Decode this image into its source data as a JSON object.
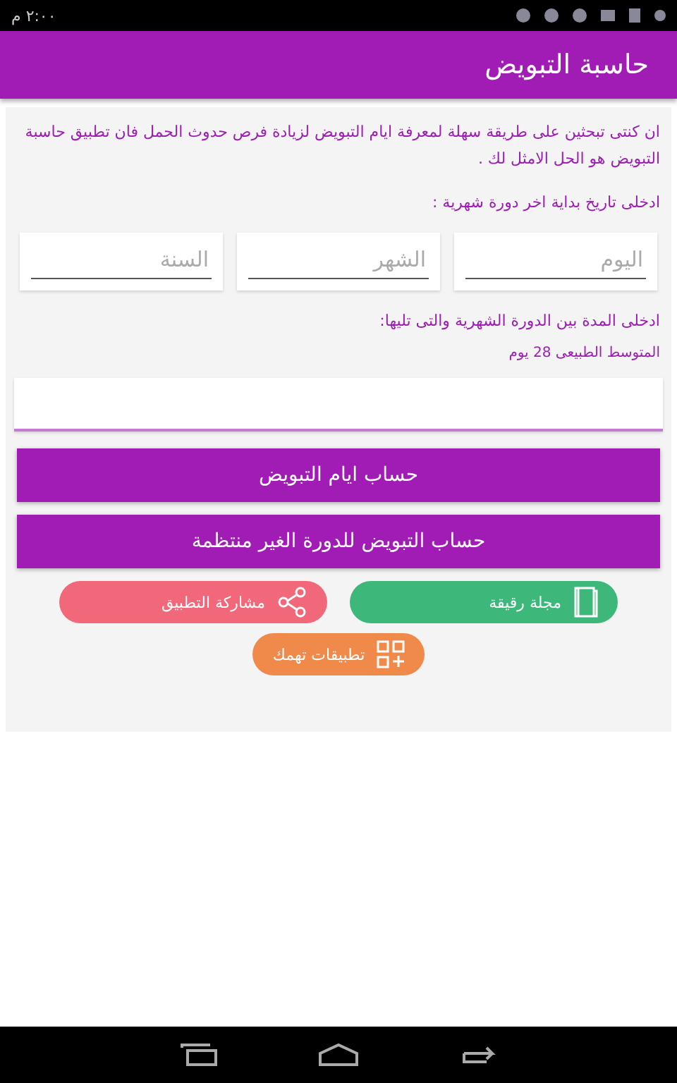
{
  "status_bar": {
    "time": "٢:٠٠ م"
  },
  "app_bar": {
    "title": "حاسبة التبويض"
  },
  "intro": "ان كنتى تبحثين على طريقة سهلة لمعرفة ايام التبويض لزيادة فرص حدوث الحمل فان تطبيق حاسبة التبويض هو الحل الامثل لك .",
  "date_label": "ادخلى تاريخ بداية اخر دورة شهرية :",
  "date_fields": [
    {
      "placeholder": "اليوم"
    },
    {
      "placeholder": "الشهر"
    },
    {
      "placeholder": "السنة"
    }
  ],
  "cycle_label": "ادخلى المدة بين الدورة الشهرية والتى تليها:",
  "cycle_hint": "المتوسط الطبيعى 28  يوم",
  "cycle_field": {
    "focused": true
  },
  "buttons": [
    "حساب ايام التبويض",
    "حساب التبويض للدورة الغير منتظمة"
  ],
  "links": [
    {
      "label": "مجلة رقيقة",
      "kind": "book",
      "color": "#3db87a"
    },
    {
      "label": "مشاركة التطبيق",
      "kind": "share",
      "color": "#f0687a"
    },
    {
      "label": "تطبيقات تهمك",
      "kind": "apps",
      "color": "#f08a4b"
    }
  ]
}
